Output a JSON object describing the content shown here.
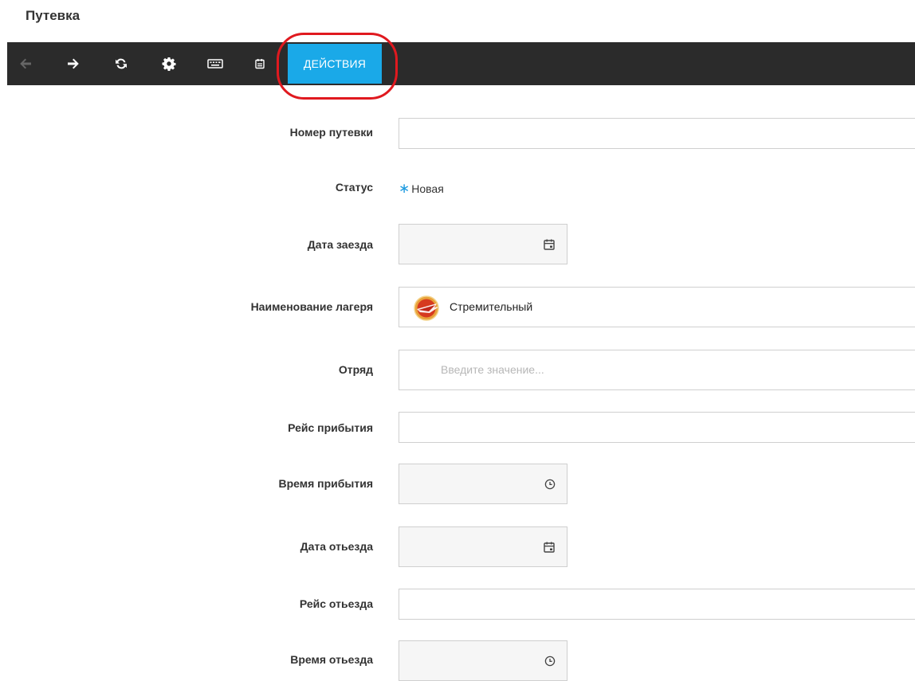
{
  "page": {
    "title": "Путевка"
  },
  "toolbar": {
    "buttons": [
      {
        "icon": "arrow-left-icon",
        "enabled": false
      },
      {
        "icon": "arrow-right-icon",
        "enabled": true
      },
      {
        "icon": "refresh-icon",
        "enabled": true
      },
      {
        "icon": "gear-icon",
        "enabled": true
      },
      {
        "icon": "keyboard-icon",
        "enabled": true
      },
      {
        "icon": "calendar-icon",
        "enabled": true
      }
    ],
    "actions_label": "ДЕЙСТВИЯ",
    "accent_color": "#1aa9e8",
    "background_color": "#2b2b2b",
    "highlight_color": "#e0191f"
  },
  "form": {
    "voucher_number": {
      "label": "Номер путевки",
      "value": ""
    },
    "status": {
      "label": "Статус",
      "value": "Новая",
      "marker": "∗"
    },
    "arrival_date": {
      "label": "Дата заезда",
      "value": ""
    },
    "camp_name": {
      "label": "Наименование лагеря",
      "value": "Стремительный"
    },
    "squad": {
      "label": "Отряд",
      "value": "",
      "placeholder": "Введите значение..."
    },
    "arrival_flight": {
      "label": "Рейс прибытия",
      "value": ""
    },
    "arrival_time": {
      "label": "Время прибытия",
      "value": ""
    },
    "departure_date": {
      "label": "Дата отьезда",
      "value": ""
    },
    "departure_flight": {
      "label": "Рейс отьезда",
      "value": ""
    },
    "departure_time": {
      "label": "Время отьезда",
      "value": ""
    }
  }
}
